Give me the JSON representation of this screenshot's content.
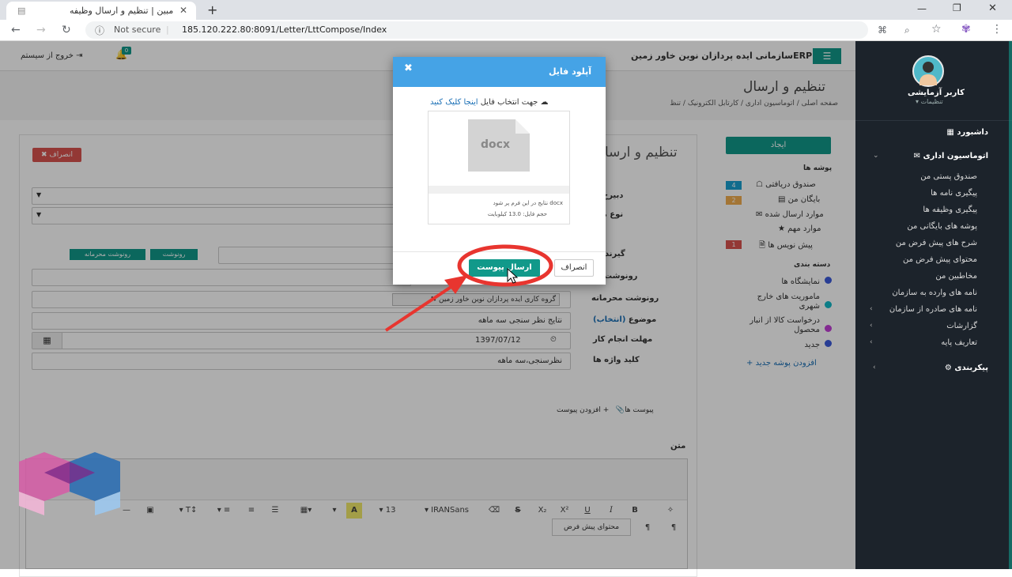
{
  "browser": {
    "tab_title": "مبین | تنظیم و ارسال وظیفه",
    "new_tab": "+",
    "security": "Not secure",
    "url": "185.120.222.80:8091/Letter/LttCompose/Index"
  },
  "header": {
    "logout": "خروج از سیستم",
    "notification_count": "0",
    "org_title": "ERPسازمانی ایده پردازان نوین خاور زمین"
  },
  "page": {
    "title": "تنظیم و ارسال",
    "breadcrumb": [
      "صفحه اصلی",
      "اتوماسیون اداری",
      "کارتابل الکترونیک",
      "تنظ"
    ],
    "panel_title": "تنظیم و ارسا",
    "cancel_button": "انصراف"
  },
  "form": {
    "secretariat_label": "دبیرخ",
    "type_label": "نوع مکا",
    "recipient_label": "گیرند",
    "cc_label": "رونوشت",
    "confidential_cc_label": "رونوشت محرمانه",
    "subject_label": "موضوع",
    "subject_select": "(انتخاب)",
    "deadline_label": "مهلت انجام کار",
    "keywords_label": "کلید واژه ها",
    "cc_btn": "رونوشت",
    "confidential_cc_btn": "رونوشت محرمانه",
    "group_tag": "گروه کاری ایده پردازان نوین خاور زمین",
    "subject_value": "نتایج نظر سنجی سه ماهه",
    "deadline_value": "1397/07/12",
    "keywords_value": "نظرسنجی،سه ماهه",
    "attachments": "پیوست ها",
    "add_attachment": "افزودن پیوست",
    "body_label": "متن",
    "default_content": "محتوای پیش فرض"
  },
  "toolbar": {
    "font": "IRANSans",
    "size": "13",
    "bold": "B",
    "italic": "I",
    "underline": "U",
    "sup": "X²",
    "sub": "X₂",
    "strike": "S"
  },
  "folders": {
    "create_button": "ایجاد",
    "folders_title": "پوشه ها",
    "inbox": "صندوق دریافتی",
    "inbox_count": "4",
    "archive": "بایگان من",
    "archive_count": "2",
    "sent": "موارد ارسال شده",
    "important": "موارد مهم",
    "drafts": "پیش نویس ها",
    "drafts_count": "1",
    "categories_title": "دسته بندی",
    "categories": [
      {
        "label": "نمایشگاه ها",
        "color": "#3b5bdb"
      },
      {
        "label": "ماموریت های خارج شهری",
        "color": "#12b8c8"
      },
      {
        "label": "درخواست کالا از انبار محصول",
        "color": "#c13fd6"
      },
      {
        "label": "جدید",
        "color": "#3b5bdb"
      }
    ],
    "add_folder": "افزودن پوشه جدید"
  },
  "sidebar": {
    "user_name": "کاربر آزمایشی",
    "settings": "تنظیمات",
    "dashboard": "داشبورد",
    "office_automation": "اتوماسیون اداری",
    "items": [
      "صندوق پستی من",
      "پیگیری نامه ها",
      "پیگیری وظیفه ها",
      "پوشه های بایگانی من",
      "شرح های پیش فرض من",
      "محتوای پیش فرض من",
      "مخاطبین من",
      "نامه های وارده به سازمان",
      "نامه های صادره از سازمان",
      "گزارشات",
      "تعاریف پایه"
    ],
    "config": "پیکربندی"
  },
  "modal": {
    "title": "آپلود فایل",
    "hint_text": "جهت انتخاب فایل",
    "hint_link": "اینجا کلیک کنید",
    "file_ext": "docx",
    "file_name": "docx نتایج در این فرم پر شود",
    "file_size": "حجم فایل: 13.0 کیلوبایت",
    "cancel": "انصراف",
    "upload": "ارسال پیوست"
  },
  "colors": {
    "modal_header": "#45a3e6",
    "primary_button": "#11998a",
    "highlight_ring": "#e8352f",
    "sidebar_bg": "#1c232b"
  }
}
